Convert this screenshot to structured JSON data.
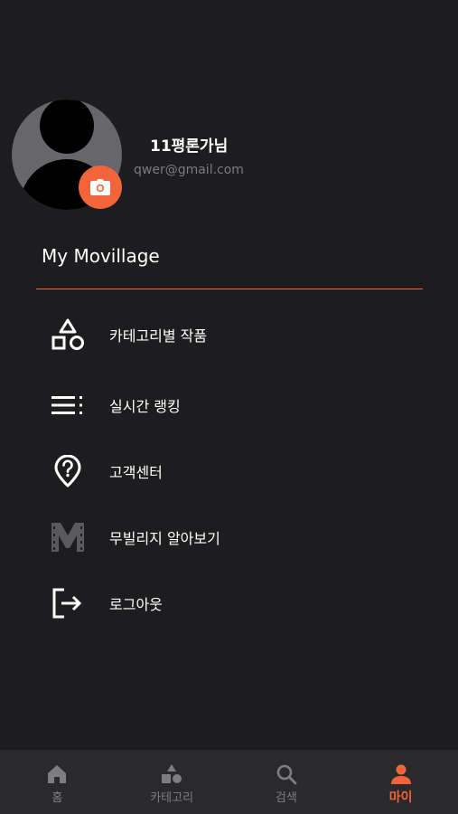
{
  "profile": {
    "name": "11평론가님",
    "email": "qwer@gmail.com"
  },
  "section": {
    "title": "My Movillage"
  },
  "menu": [
    {
      "label": "카테고리별 작품",
      "icon": "shapes-icon"
    },
    {
      "label": "실시간 랭킹",
      "icon": "list-icon"
    },
    {
      "label": "고객센터",
      "icon": "help-pin-icon"
    },
    {
      "label": "무빌리지 알아보기",
      "icon": "movillage-logo-icon"
    },
    {
      "label": "로그아웃",
      "icon": "logout-icon"
    }
  ],
  "tabs": [
    {
      "label": "홈",
      "icon": "home-icon",
      "active": false
    },
    {
      "label": "카테고리",
      "icon": "category-icon",
      "active": false
    },
    {
      "label": "검색",
      "icon": "search-icon",
      "active": false
    },
    {
      "label": "마이",
      "icon": "person-icon",
      "active": true
    }
  ],
  "colors": {
    "background": "#1d1d1f",
    "accent": "#f2653a",
    "tabbar": "#2a2a2d",
    "muted": "#7b7b80"
  }
}
